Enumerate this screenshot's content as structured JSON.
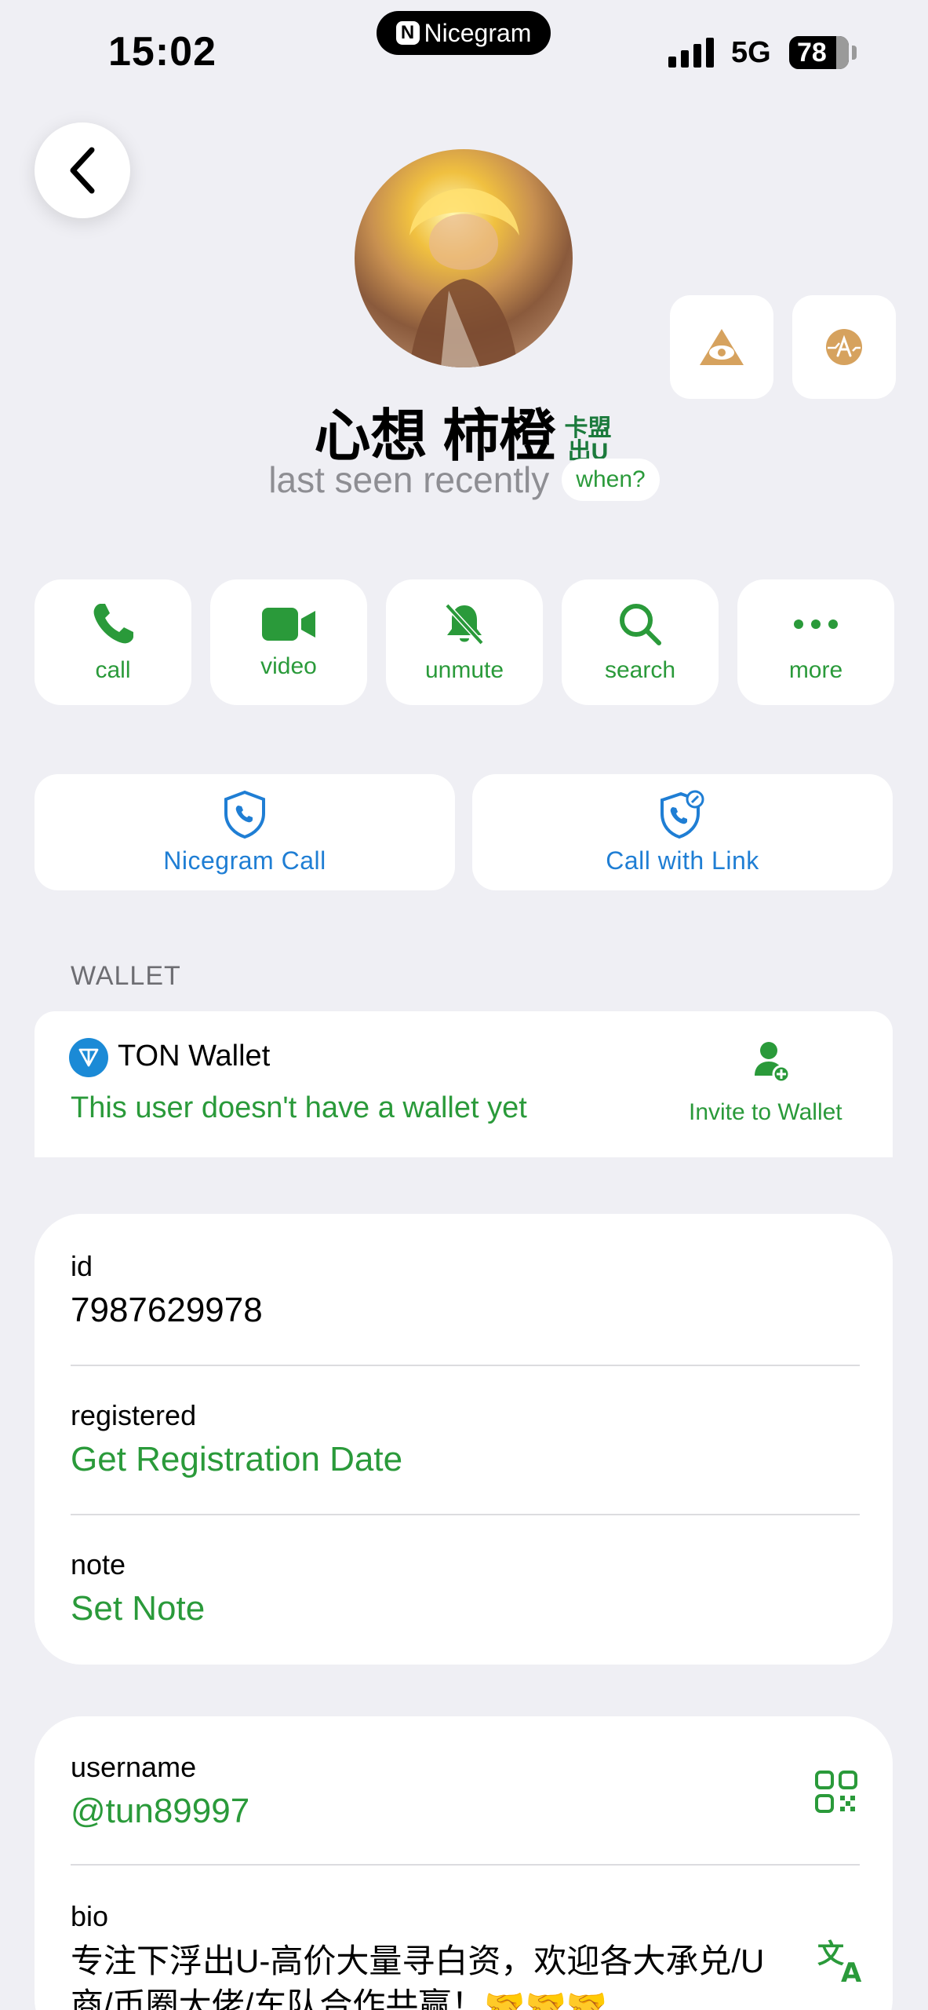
{
  "status_bar": {
    "time": "15:02",
    "island_label": "Nicegram",
    "island_logo": "N",
    "network": "5G",
    "battery": "78"
  },
  "header": {
    "name": "心想 柿橙",
    "name_badge": "卡盟出U",
    "last_seen": "last seen recently",
    "when_label": "when?"
  },
  "actions": [
    {
      "label": "call",
      "icon": "phone-icon"
    },
    {
      "label": "video",
      "icon": "video-icon"
    },
    {
      "label": "unmute",
      "icon": "bell-slash-icon"
    },
    {
      "label": "search",
      "icon": "search-icon"
    },
    {
      "label": "more",
      "icon": "more-icon"
    }
  ],
  "calls": {
    "nicegram_call": "Nicegram Call",
    "call_with_link": "Call with Link"
  },
  "wallet": {
    "section_header": "WALLET",
    "title": "TON Wallet",
    "status": "This user doesn't have a wallet yet",
    "invite_label": "Invite to Wallet"
  },
  "info": {
    "id_label": "id",
    "id_value": "7987629978",
    "registered_label": "registered",
    "registered_value": "Get Registration Date",
    "note_label": "note",
    "note_value": "Set Note"
  },
  "profile": {
    "username_label": "username",
    "username_value": "@tun89997",
    "bio_label": "bio",
    "bio_value": "专注下浮出U-高价大量寻白资，欢迎各大承兑/U商/币圈大佬/车队合作共赢！🤝🤝🤝"
  },
  "colors": {
    "accent_green": "#2a9a3a",
    "link_blue": "#1f7ed4",
    "background": "#efeff4"
  }
}
